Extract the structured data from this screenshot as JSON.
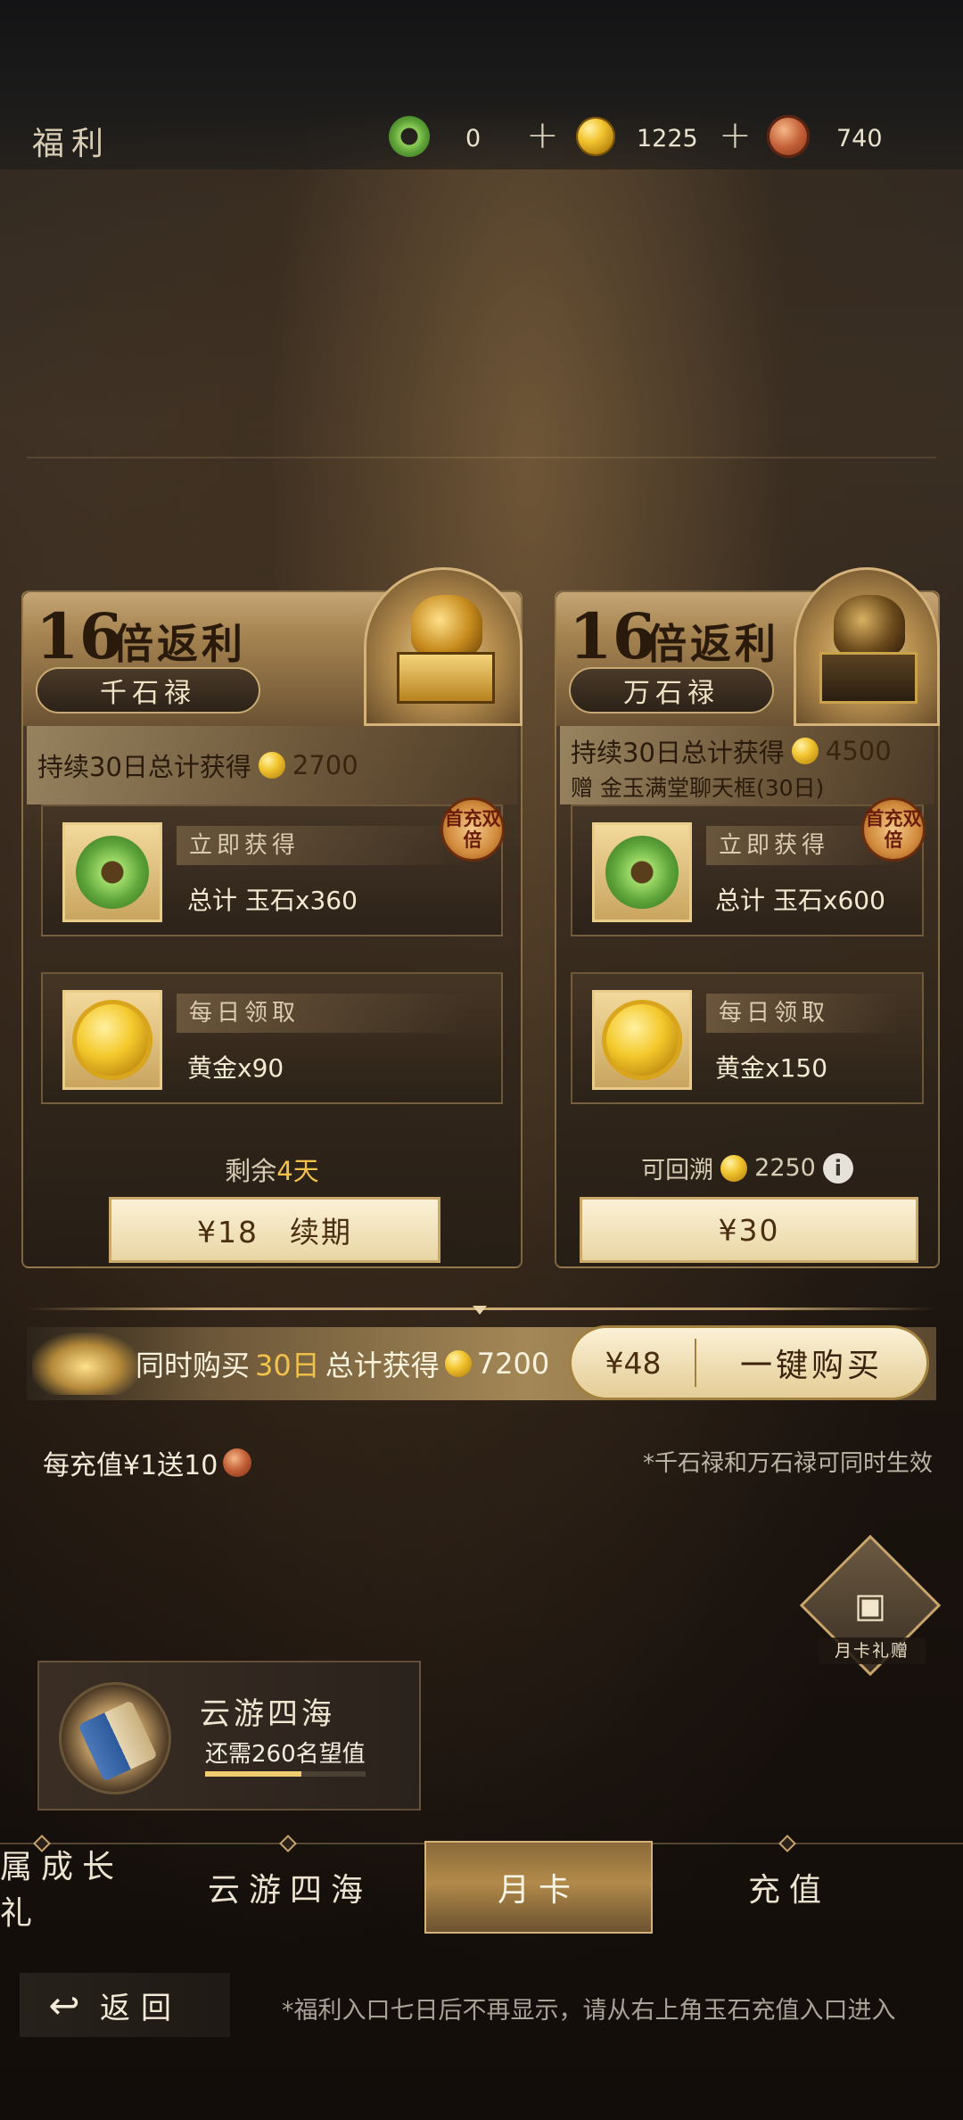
{
  "header": {
    "title": "福利",
    "resources": [
      {
        "icon": "jade-ring-icon",
        "value": "0"
      },
      {
        "icon": "gold-coin-icon",
        "value": "1225"
      },
      {
        "icon": "bronze-token-icon",
        "value": "740"
      }
    ],
    "plus_symbol": "+"
  },
  "cards": [
    {
      "multiplier": "16",
      "headline": "倍返利",
      "name": "千石禄",
      "total_prefix": "持续30日总计获得",
      "total_value": "2700",
      "gift_text": "",
      "badge": "首充双倍",
      "rewards": [
        {
          "label": "立即获得",
          "text": "总计 玉石x360",
          "icon": "jade-ring-icon"
        },
        {
          "label": "每日领取",
          "text": "黄金x90",
          "icon": "gold-coin-icon"
        }
      ],
      "remain_prefix": "剩余",
      "remain_days": "4天",
      "price_label": "¥18　续期"
    },
    {
      "multiplier": "16",
      "headline": "倍返利",
      "name": "万石禄",
      "total_prefix": "持续30日总计获得",
      "total_value": "4500",
      "gift_text": "赠 金玉满堂聊天框(30日)",
      "badge": "首充双倍",
      "rewards": [
        {
          "label": "立即获得",
          "text": "总计 玉石x600",
          "icon": "jade-ring-icon"
        },
        {
          "label": "每日领取",
          "text": "黄金x150",
          "icon": "gold-coin-icon"
        }
      ],
      "retro_label": "可回溯",
      "retro_value": "2250",
      "price_label": "¥30"
    }
  ],
  "bundle": {
    "text_a": "同时购买",
    "text_days": "30日",
    "text_b": "总计获得",
    "value": "7200",
    "price": "¥48",
    "button_label": "一键购买"
  },
  "recharge_note": "每充值¥1送10",
  "simultaneous_note": "*千石禄和万石禄可同时生效",
  "monthly_gift_label": "月卡礼赠",
  "quest": {
    "title": "云游四海",
    "subtitle": "还需260名望值",
    "progress_fraction": 0.6
  },
  "tabs": [
    {
      "label": "属成长礼",
      "active": false
    },
    {
      "label": "云游四海",
      "active": false
    },
    {
      "label": "月卡",
      "active": true
    },
    {
      "label": "充值",
      "active": false
    }
  ],
  "footer": {
    "back_label": "返回",
    "note": "*福利入口七日后不再显示，请从右上角玉石充值入口进入"
  },
  "colors": {
    "accent_gold": "#f2c24a",
    "panel_brown": "#3a2e24",
    "button_cream": "#fbf1d6"
  }
}
